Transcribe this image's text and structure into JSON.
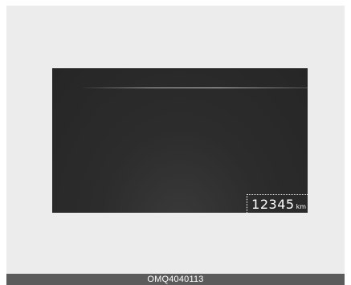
{
  "display": {
    "odometer": {
      "value": "12345",
      "unit": "km"
    }
  },
  "caption": {
    "code": "OMQ4040113"
  },
  "colors": {
    "frame_background": "#ececec",
    "display_background": "#2c2c2c",
    "caption_background": "#5b5b5b",
    "text": "#ffffff"
  }
}
